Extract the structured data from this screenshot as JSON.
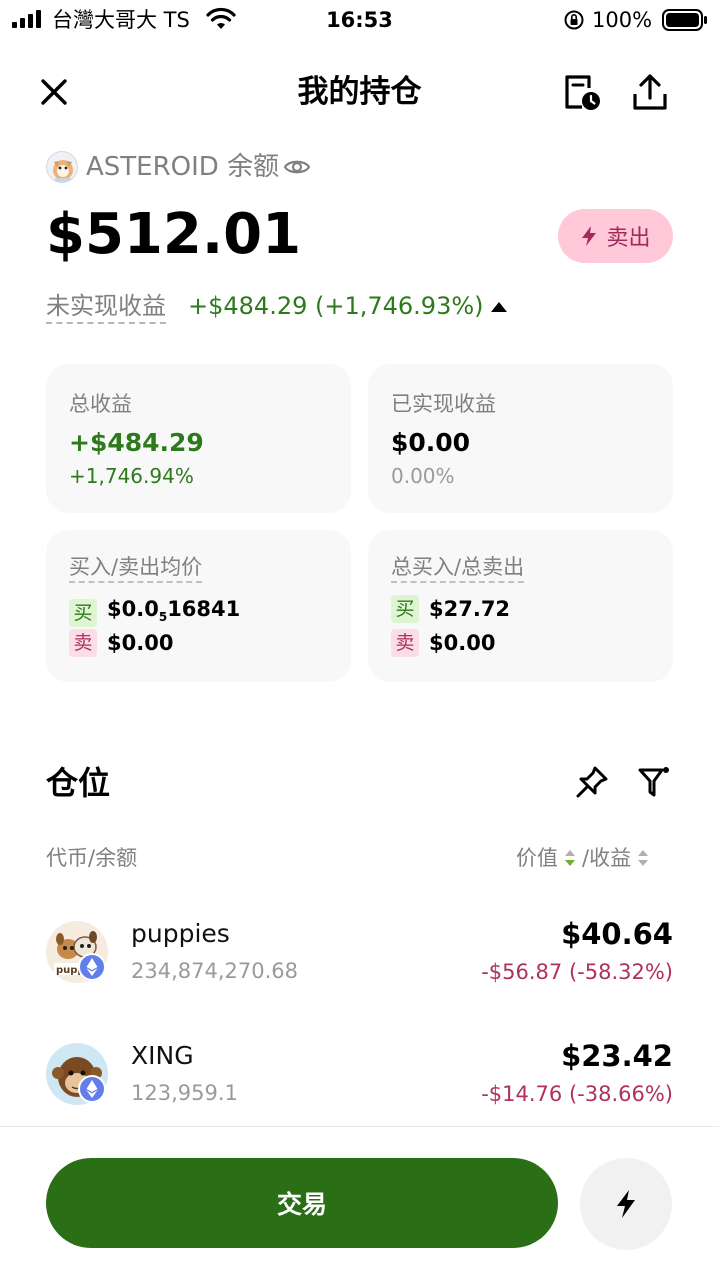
{
  "status_bar": {
    "carrier": "台灣大哥大 TS",
    "time": "16:53",
    "battery": "100%"
  },
  "header": {
    "title": "我的持仓",
    "icons": [
      "close-icon",
      "history-icon",
      "share-icon"
    ]
  },
  "summary": {
    "token_label": "ASTEROID 余额",
    "total_value": "$512.01",
    "sell_label": "卖出",
    "unrealized_label": "未实现收益",
    "unrealized_value": "+$484.29 (+1,746.93%)"
  },
  "cards": {
    "total_pnl": {
      "label": "总收益",
      "value": "+$484.29",
      "percent": "+1,746.94%"
    },
    "realized_pnl": {
      "label": "已实现收益",
      "value": "$0.00",
      "percent": "0.00%"
    },
    "avg_price": {
      "label": "买入/卖出均价",
      "buy_tag": "买",
      "buy_value_prefix": "$0.0",
      "buy_value_sub": "5",
      "buy_value_suffix": "16841",
      "sell_tag": "卖",
      "sell_value": "$0.00"
    },
    "total_trade": {
      "label": "总买入/总卖出",
      "buy_tag": "买",
      "buy_value": "$27.72",
      "sell_tag": "卖",
      "sell_value": "$0.00"
    }
  },
  "positions": {
    "title": "仓位",
    "col_left": "代币/余额",
    "col_right_value": "价值",
    "col_right_pnl": "/收益",
    "items": [
      {
        "name": "puppies",
        "amount": "234,874,270.68",
        "value": "$40.64",
        "pnl": "-$56.87 (-58.32%)"
      },
      {
        "name": "XING",
        "amount": "123,959.1",
        "value": "$23.42",
        "pnl": "-$14.76 (-38.66%)"
      }
    ]
  },
  "bottom": {
    "trade_label": "交易"
  },
  "colors": {
    "profit": "#2d7a1c",
    "loss": "#b03060",
    "trade_button": "#2a6e16",
    "sell_pill": "#ffc9d9"
  }
}
